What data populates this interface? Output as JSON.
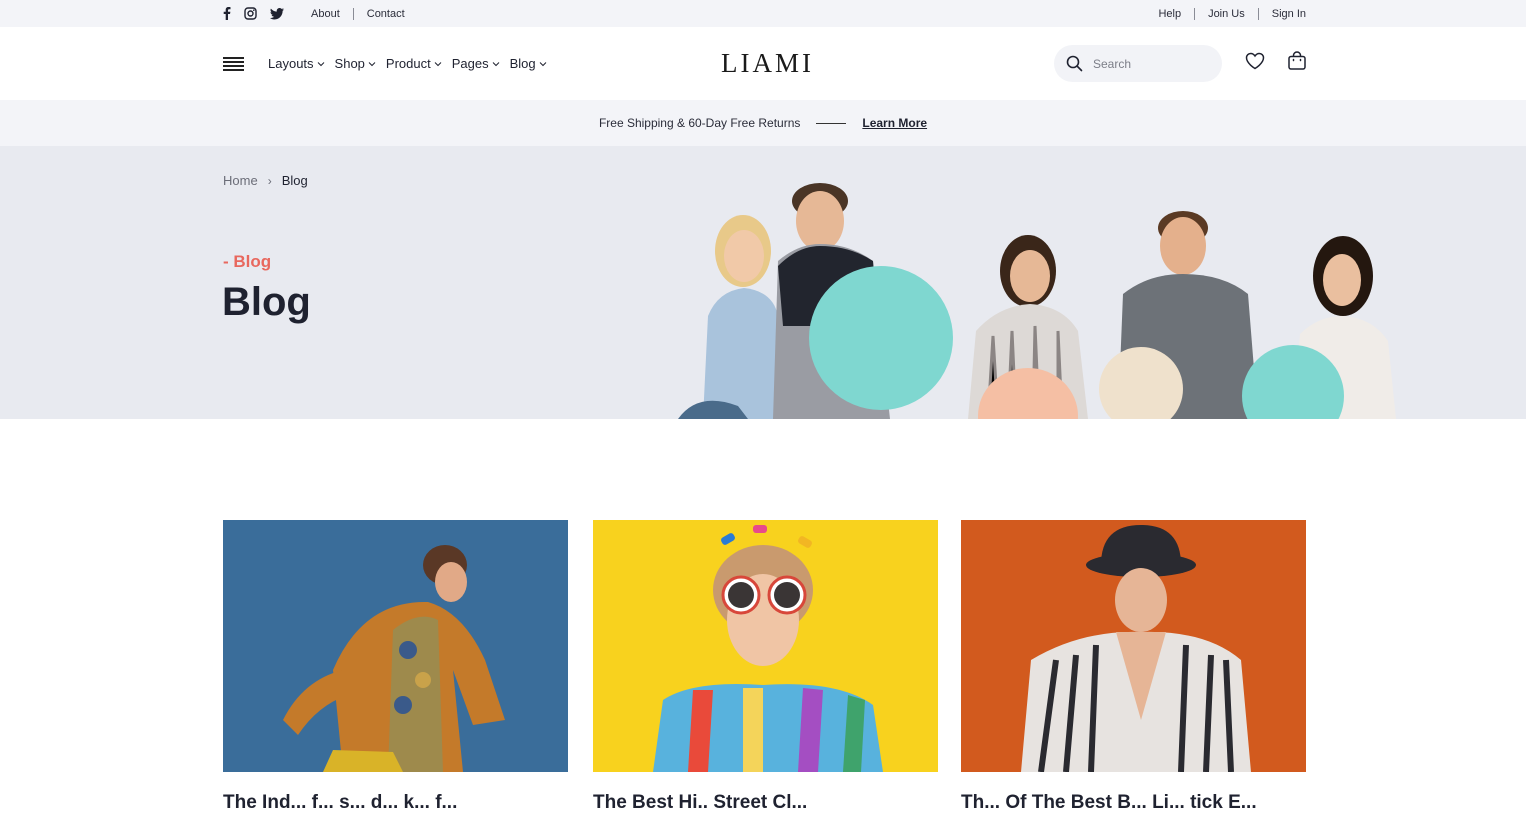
{
  "topbar": {
    "social": [
      "facebook-icon",
      "instagram-icon",
      "twitter-icon"
    ],
    "left_links": [
      "About",
      "Contact"
    ],
    "right_links": [
      "Help",
      "Join Us",
      "Sign In"
    ]
  },
  "header": {
    "nav": [
      {
        "label": "Layouts"
      },
      {
        "label": "Shop"
      },
      {
        "label": "Product"
      },
      {
        "label": "Pages"
      },
      {
        "label": "Blog"
      }
    ],
    "logo": "LIAMI",
    "search_placeholder": "Search"
  },
  "announcement": {
    "text": "Free Shipping & 60-Day Free Returns",
    "link": "Learn More"
  },
  "hero": {
    "breadcrumb": {
      "home": "Home",
      "current": "Blog"
    },
    "eyebrow": "- Blog",
    "title": "Blog"
  },
  "posts": [
    {
      "title": "The Ind... f... s... d... k... f..."
    },
    {
      "title": "The Best Hi.. Street Cl..."
    },
    {
      "title": "Th... Of The Best B... Li... tick E..."
    }
  ],
  "colors": {
    "accent": "#e8685e",
    "hero_bg": "#e8eaf0",
    "bar_bg": "#f3f4f8",
    "card1": "#3a6d9a",
    "card2": "#f8d21e",
    "card3": "#d25a1e"
  }
}
